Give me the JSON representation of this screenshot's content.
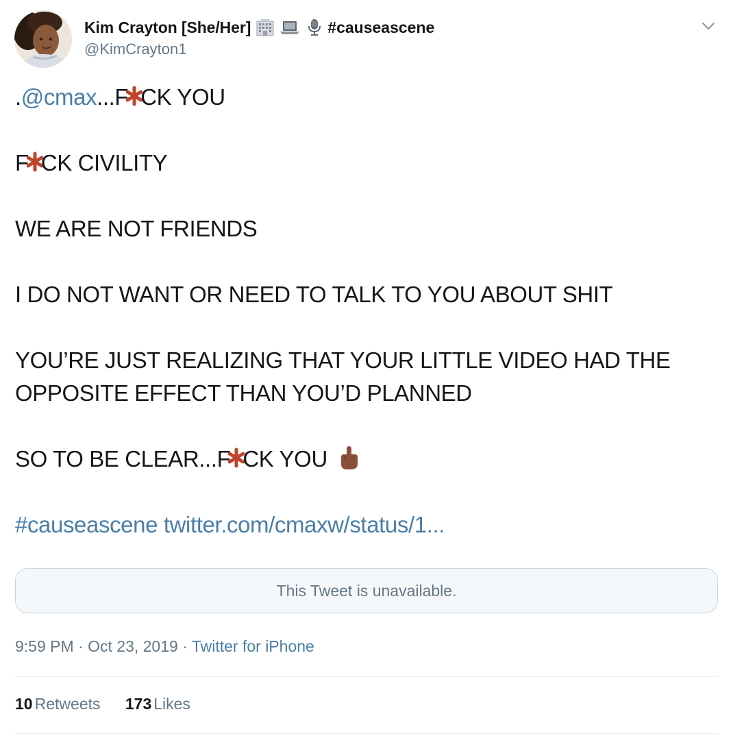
{
  "author": {
    "display_name": "Kim Crayton [She/Her]",
    "name_icons": [
      "office-building-icon",
      "laptop-icon",
      "microphone-icon"
    ],
    "name_hashtag": "#causeascene",
    "handle": "@KimCrayton1"
  },
  "tweet": {
    "lines": {
      "l1_prefix": ".",
      "l1_mention": "@cmax",
      "l1_a": "...F",
      "l1_b": "CK YOU",
      "l2_a": "F",
      "l2_b": "CK CIVILITY",
      "l3": "WE ARE NOT FRIENDS",
      "l4": "I DO NOT WANT OR NEED TO TALK TO YOU ABOUT SHIT",
      "l5": "YOU’RE JUST REALIZING THAT YOUR LITTLE VIDEO HAD THE",
      "l6": "OPPOSITE EFFECT THAN YOU’D PLANNED",
      "l7_a": "SO TO BE CLEAR...F",
      "l7_b": "CK YOU",
      "l8_hashtag": "#causeascene",
      "l8_link": "twitter.com/cmaxw/status/1..."
    },
    "censor_icon": "red-asterisk-icon",
    "emoji": "middle-finger-icon"
  },
  "quoted_tweet": {
    "text": "This Tweet is unavailable."
  },
  "meta": {
    "time": "9:59 PM",
    "sep1": " · ",
    "date": "Oct 23, 2019",
    "sep2": " · ",
    "source": "Twitter for iPhone"
  },
  "stats": {
    "retweets_count": "10",
    "retweets_label": "Retweets",
    "likes_count": "173",
    "likes_label": "Likes"
  },
  "colors": {
    "link": "#4a7ea8",
    "secondary_text": "#657786",
    "censor_red": "#c1432b",
    "divider": "#e6ecf0"
  }
}
